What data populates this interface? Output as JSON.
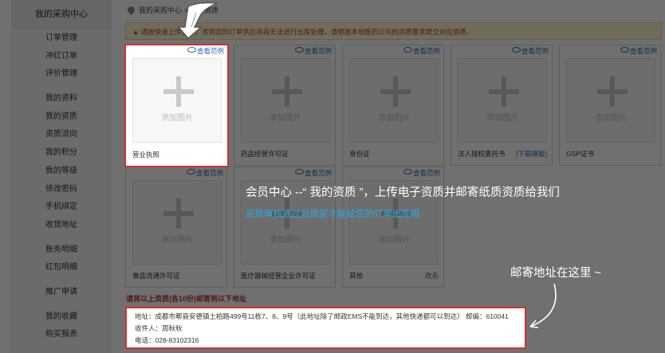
{
  "sidebar": {
    "title": "我的采购中心",
    "groups": [
      [
        "订单管理",
        "冲红订单",
        "评价管理"
      ],
      [
        "我的资料",
        "我的资质",
        "资质流向",
        "我的积分",
        "我的等级",
        "修改密码",
        "手机绑定",
        "收货地址"
      ],
      [
        "账务明细",
        "红包明细"
      ],
      [
        "推广申请"
      ],
      [
        "我的收藏",
        "购买报表"
      ]
    ]
  },
  "breadcrumb": "我的采购中心 > 我的资质",
  "notice": "▲ 请按快速上传资质，否则您的订单供应商将无法进行出库处理。请根据本地医药公司的资质要求提交对应资质。",
  "view_sample": "查看范例",
  "add_image": "添加图片",
  "cards": [
    {
      "name": "营业执照",
      "link": ""
    },
    {
      "name": "药品经营许可证",
      "link": ""
    },
    {
      "name": "身份证",
      "link": ""
    },
    {
      "name": "法人授权委托书",
      "link": "[下载模板]"
    },
    {
      "name": "GSP证书",
      "link": ""
    },
    {
      "name": "食品流通许可证",
      "link": ""
    },
    {
      "name": "医疗器械经营企业许可证",
      "link": ""
    },
    {
      "name": "其他",
      "link": "改名"
    }
  ],
  "send_title": "请将以上资质(各10份)邮寄到以下地址",
  "address": {
    "line1": "地址：成都市郫县安德镇土柏路499号11栋7、8、9号（此地址除了邮政EMS不能到达，其他快递都可以到达）   邮编：610041",
    "line2": "收件人：周秋秋",
    "line3": "电话：028-83102316"
  },
  "annotations": {
    "main": "会员中心 --“ 我的资质 ”，上传电子资质并邮寄纸质资质给我们",
    "sub": "资质审核通过后商家才能给您的订单出库哦",
    "mail": "邮寄地址在这里 ~"
  },
  "colors": {
    "highlight": "#d32f2f",
    "link": "#2a6db8",
    "annotation_blue": "#28a9e6"
  }
}
